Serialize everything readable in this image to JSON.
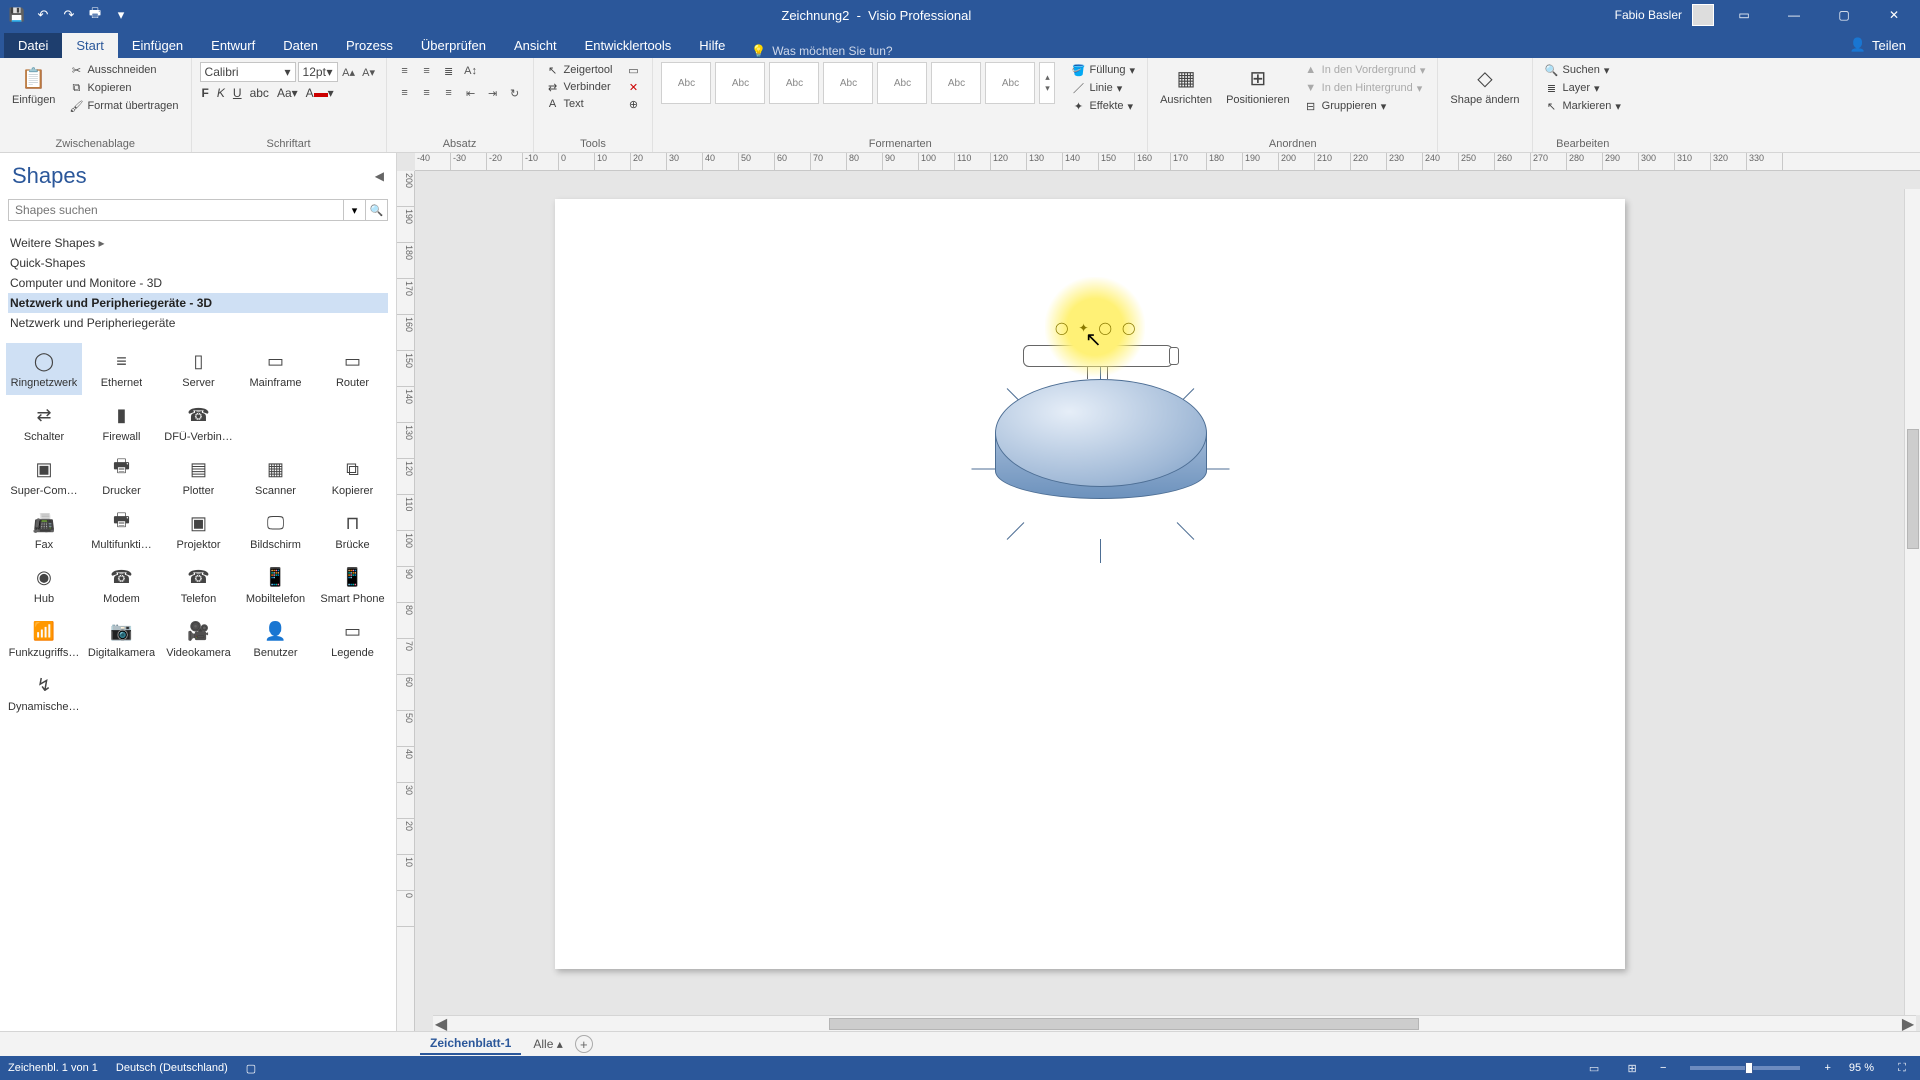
{
  "titlebar": {
    "doc_title": "Zeichnung2",
    "app_name": "Visio Professional",
    "user_name": "Fabio Basler"
  },
  "tabs": {
    "file": "Datei",
    "items": [
      "Start",
      "Einfügen",
      "Entwurf",
      "Daten",
      "Prozess",
      "Überprüfen",
      "Ansicht",
      "Entwicklertools",
      "Hilfe"
    ],
    "active": "Start",
    "tellme_placeholder": "Was möchten Sie tun?",
    "share": "Teilen"
  },
  "ribbon": {
    "clipboard": {
      "paste": "Einfügen",
      "cut": "Ausschneiden",
      "copy": "Kopieren",
      "format_painter": "Format übertragen",
      "label": "Zwischenablage"
    },
    "font": {
      "name": "Calibri",
      "size": "12pt",
      "label": "Schriftart"
    },
    "paragraph": {
      "label": "Absatz"
    },
    "tools": {
      "pointer": "Zeigertool",
      "connector": "Verbinder",
      "text": "Text",
      "label": "Tools"
    },
    "styles": {
      "item": "Abc",
      "label": "Formenarten",
      "fill": "Füllung",
      "line": "Linie",
      "effects": "Effekte"
    },
    "arrange": {
      "align": "Ausrichten",
      "position": "Positionieren",
      "bring_front": "In den Vordergrund",
      "send_back": "In den Hintergrund",
      "group": "Gruppieren",
      "label": "Anordnen",
      "shape_change": "Shape ändern"
    },
    "editing": {
      "find": "Suchen",
      "layer": "Layer",
      "select": "Markieren",
      "label": "Bearbeiten"
    }
  },
  "shapes": {
    "title": "Shapes",
    "search_placeholder": "Shapes suchen",
    "stencils": {
      "more": "Weitere Shapes",
      "items": [
        "Quick-Shapes",
        "Computer und Monitore - 3D",
        "Netzwerk und Peripheriegeräte - 3D",
        "Netzwerk und Peripheriegeräte"
      ],
      "selected": "Netzwerk und Peripheriegeräte - 3D"
    },
    "grid": [
      "Ringnetzwerk",
      "Ethernet",
      "Server",
      "Mainframe",
      "Router",
      "Schalter",
      "Firewall",
      "DFÜ-Verbin…",
      "",
      "",
      "Super-Com…",
      "Drucker",
      "Plotter",
      "Scanner",
      "Kopierer",
      "Fax",
      "Multifunkti…",
      "Projektor",
      "Bildschirm",
      "Brücke",
      "Hub",
      "Modem",
      "Telefon",
      "Mobiltelefon",
      "Smart Phone",
      "Funkzugriffs…",
      "Digitalkamera",
      "Videokamera",
      "Benutzer",
      "Legende",
      "Dynamischer Verbinder",
      "",
      "",
      "",
      ""
    ],
    "selected_shape": "Ringnetzwerk"
  },
  "sheet": {
    "tab": "Zeichenblatt-1",
    "all": "Alle"
  },
  "status": {
    "page_info": "Zeichenbl. 1 von 1",
    "lang": "Deutsch (Deutschland)",
    "zoom": "95 %"
  },
  "ruler_h": [
    "-40",
    "-30",
    "-20",
    "-10",
    "0",
    "10",
    "20",
    "30",
    "40",
    "50",
    "60",
    "70",
    "80",
    "90",
    "100",
    "110",
    "120",
    "130",
    "140",
    "150",
    "160",
    "170",
    "180",
    "190",
    "200",
    "210",
    "220",
    "230",
    "240",
    "250",
    "260",
    "270",
    "280",
    "290",
    "300",
    "310",
    "320",
    "330"
  ],
  "ruler_v": [
    "200",
    "190",
    "180",
    "170",
    "160",
    "150",
    "140",
    "130",
    "120",
    "110",
    "100",
    "90",
    "80",
    "70",
    "60",
    "50",
    "40",
    "30",
    "20",
    "10",
    "0"
  ]
}
